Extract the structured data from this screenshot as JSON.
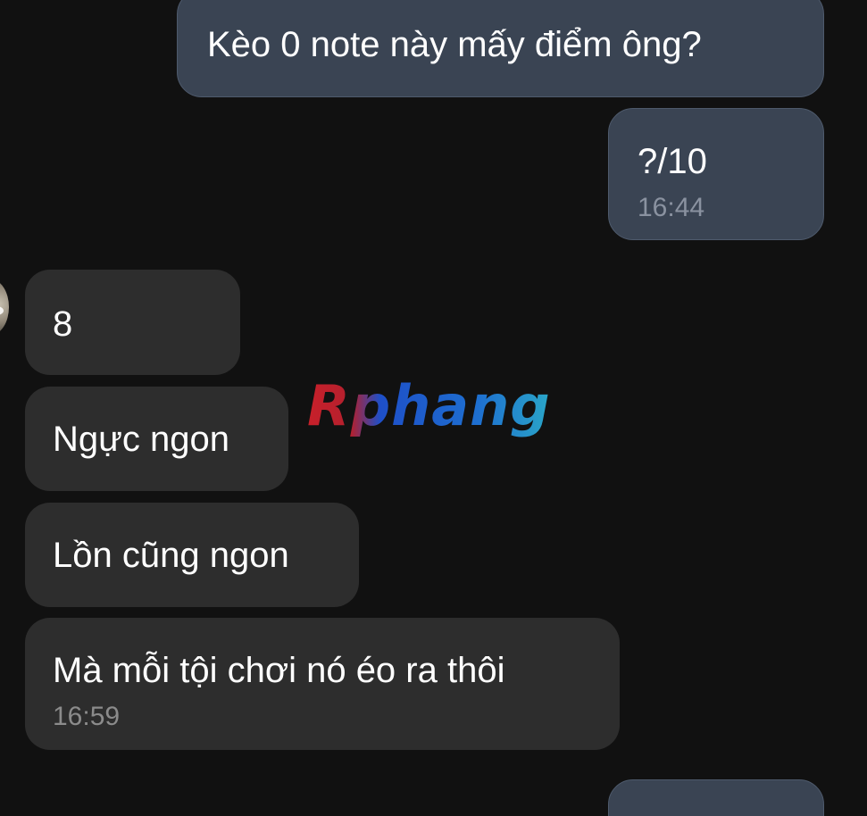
{
  "messages": [
    {
      "direction": "outgoing",
      "text": "Kèo 0 note này mấy điểm ông?"
    },
    {
      "direction": "outgoing",
      "text": "?/10",
      "time": "16:44"
    },
    {
      "direction": "incoming",
      "text": "8"
    },
    {
      "direction": "incoming",
      "text": "Ngực ngon"
    },
    {
      "direction": "incoming",
      "text": "Lồn cũng ngon"
    },
    {
      "direction": "incoming",
      "text": "Mà mỗi tội chơi nó éo ra thôi",
      "time": "16:59"
    }
  ],
  "watermark": {
    "text": "Rphang"
  },
  "colors": {
    "background": "#111111",
    "outgoing_bubble": "#3a4453",
    "incoming_bubble": "#2d2d2d",
    "timestamp": "#8a92a0",
    "watermark_red": "#c8202a",
    "watermark_blue": "#1e6fd0",
    "watermark_cyan": "#2aa6c8"
  },
  "icons": {
    "avatar": "contact-avatar"
  }
}
